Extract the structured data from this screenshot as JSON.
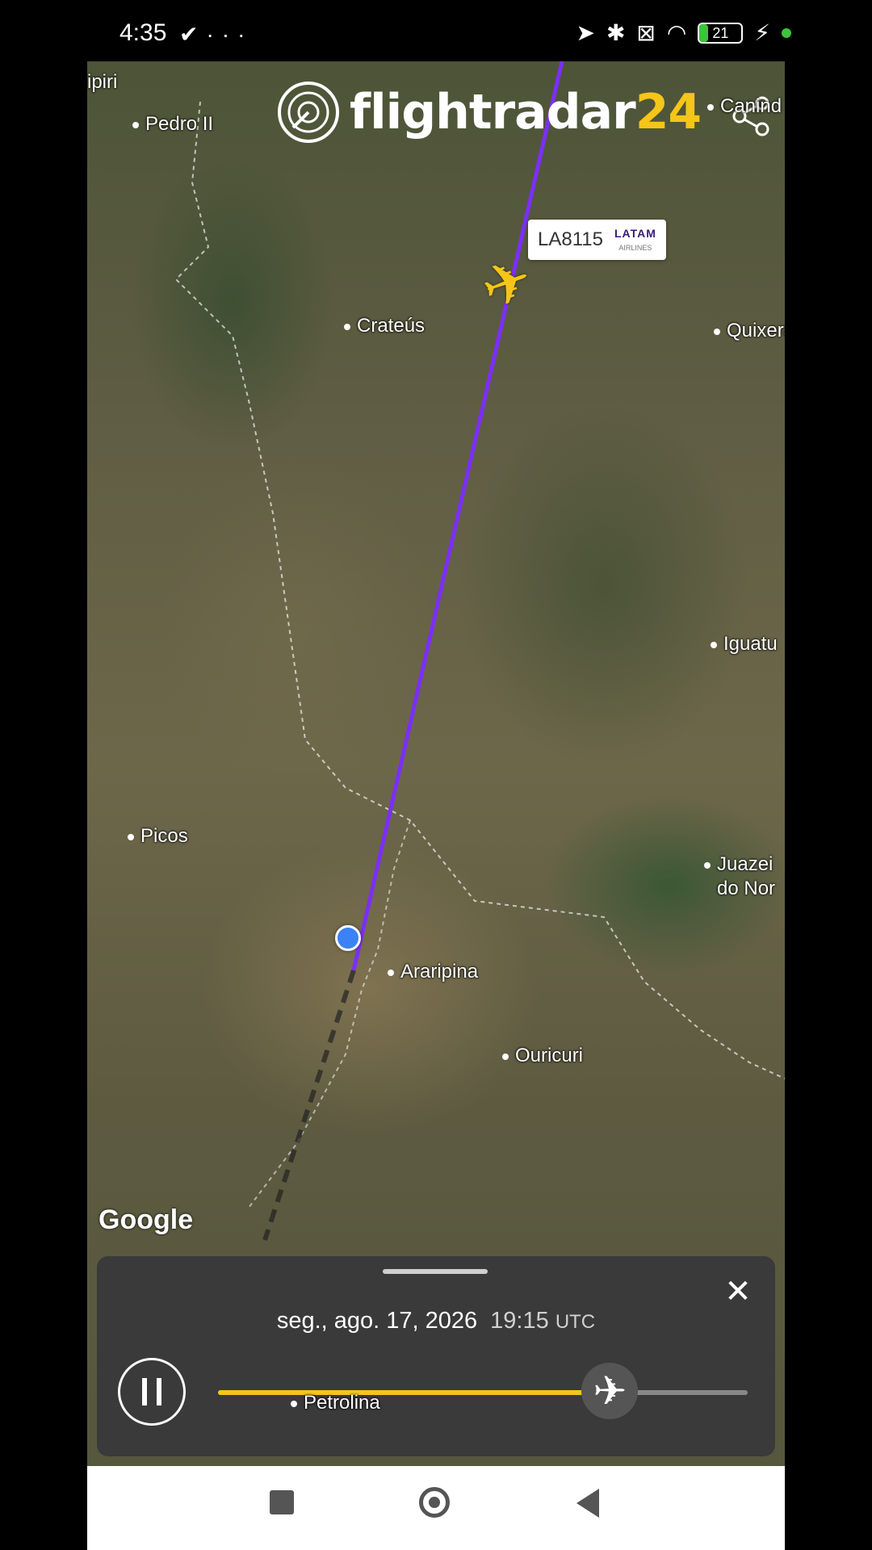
{
  "status_bar": {
    "time": "4:35",
    "left_icons": [
      "check-icon",
      "more-icon"
    ],
    "right_icons": [
      "location-icon",
      "bluetooth-icon",
      "sim-icon",
      "wifi-icon"
    ],
    "battery_level": "21",
    "battery_fraction": 0.21
  },
  "map": {
    "brand": {
      "word": "flightradar",
      "num": "24"
    },
    "places": {
      "ipiri": "ipiri",
      "pedro_ii": "Pedro II",
      "canind": "Canind",
      "crateus": "Crateús",
      "quixera": "Quixera",
      "iguatu": "Iguatu",
      "picos": "Picos",
      "juazeiro_1": "Juazei",
      "juazeiro_2": "do Nor",
      "araripina": "Araripina",
      "ouricuri": "Ouricuri",
      "petrolina": "Petrolina"
    },
    "flight": {
      "callsign": "LA8115",
      "airline_logo": "LATAM",
      "airline_sub": "AIRLINES"
    },
    "attribution": "Google",
    "colors": {
      "track": "#7b2ff7",
      "plane": "#f5c518"
    }
  },
  "playback": {
    "date": "seg., ago. 17, 2026",
    "time": "19:15",
    "tz": "UTC",
    "progress": 0.74
  },
  "nav": {
    "buttons": [
      "recents-icon",
      "home-icon",
      "back-icon"
    ]
  }
}
